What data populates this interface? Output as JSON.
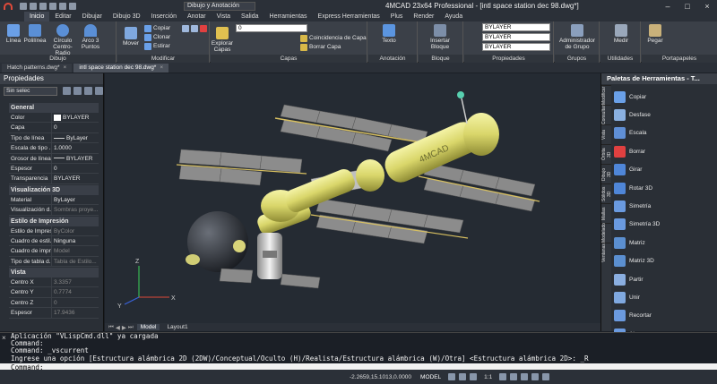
{
  "titlebar": {
    "workspace": "Dibujo y Anotación",
    "title": "4MCAD 23x64 Professional - [intl space station dec 98.dwg*]"
  },
  "ribbon_tabs": [
    "Inicio",
    "Editar",
    "Dibujar",
    "Dibujo 3D",
    "Inserción",
    "Anotar",
    "Vista",
    "Salida",
    "Herramientas",
    "Express Herramientas",
    "Plus",
    "Render",
    "Ayuda"
  ],
  "ribbon": {
    "draw_group": "Dibujo",
    "draw_tools": {
      "line": "Línea",
      "polyline": "Polilínea",
      "circle": "Círculo",
      "circle_sub": "Centro-Radio",
      "arc": "Arco 3",
      "arc_sub": "Puntos"
    },
    "modify_group": "Modificar",
    "modify_tools": {
      "move": "Mover",
      "copy": "Copiar",
      "clone": "Clonar",
      "stretch": "Estirar"
    },
    "layers_group": "Capas",
    "layer_tools": {
      "explore": "Explorar",
      "explore_sub": "Capas",
      "match": "Coincidencia de Capa",
      "delete": "Borrar Capa"
    },
    "layer_value": "0",
    "annotation_group": "Anotación",
    "annotation_tools": {
      "text": "Texto"
    },
    "block_group": "Bloque",
    "block_tools": {
      "insert": "Insertar",
      "insert_sub": "Bloque"
    },
    "properties_group": "Propiedades",
    "property_values": {
      "color": "BYLAYER",
      "linetype": "BYLAYER",
      "lineweight": "BYLAYER"
    },
    "groups_group": "Grupos",
    "group_tools": {
      "manager": "Administrador",
      "manager_sub": "de Grupo"
    },
    "utilities_group": "Utilidades",
    "utility_tools": {
      "measure": "Medir"
    },
    "clipboard_group": "Portapapeles",
    "clipboard_tools": {
      "paste": "Pegar"
    }
  },
  "doc_tabs": [
    "Hatch patterns.dwg*",
    "intl space station dec 98.dwg*"
  ],
  "properties": {
    "title": "Propiedades",
    "selection": "Sin selec",
    "categories": [
      {
        "name": "General",
        "rows": [
          {
            "k": "Color",
            "v": "BYLAYER",
            "kind": "swatch"
          },
          {
            "k": "Capa",
            "v": "0"
          },
          {
            "k": "Tipo de línea",
            "v": "ByLayer",
            "kind": "line"
          },
          {
            "k": "Escala de tipo ...",
            "v": "1.0000"
          },
          {
            "k": "Grosor de línea",
            "v": "BYLAYER",
            "kind": "line"
          },
          {
            "k": "Espesor",
            "v": "0"
          },
          {
            "k": "Transparencia",
            "v": "BYLAYER"
          }
        ]
      },
      {
        "name": "Visualización 3D",
        "rows": [
          {
            "k": "Material",
            "v": "ByLayer"
          },
          {
            "k": "Visualización d...",
            "v": "Sombras proye...",
            "dim": true
          }
        ]
      },
      {
        "name": "Estilo de Impresión",
        "rows": [
          {
            "k": "Estilo de Impres...",
            "v": "ByColor",
            "dim": true
          },
          {
            "k": "Cuadro de estil...",
            "v": "Ninguna"
          },
          {
            "k": "Cuadro de impr...",
            "v": "Model",
            "dim": true
          },
          {
            "k": "Tipo de tabla d...",
            "v": "Tabla de Estilo...",
            "dim": true
          }
        ]
      },
      {
        "name": "Vista",
        "rows": [
          {
            "k": "Centro X",
            "v": "3.3357",
            "dim": true
          },
          {
            "k": "Centro Y",
            "v": "0.7774",
            "dim": true
          },
          {
            "k": "Centro Z",
            "v": "0",
            "dim": true
          },
          {
            "k": "Espesor",
            "v": "17.9436",
            "dim": true
          }
        ]
      }
    ]
  },
  "viewport": {
    "label_text": "4MCAD",
    "tabs": [
      "Model",
      "Layout1"
    ]
  },
  "palette": {
    "title": "Paletas de Herramientas - T...",
    "vertical_tabs": [
      "Modificar",
      "Consultar",
      "Vista",
      "Órbita 3D",
      "Dibujo 3D",
      "Sólidos 3D",
      "Mallas",
      "Modelado",
      "Ventanas"
    ],
    "items": [
      {
        "label": "Copiar",
        "color": "#6aa0e8"
      },
      {
        "label": "Desfase",
        "color": "#8ab0e0"
      },
      {
        "label": "Escala",
        "color": "#5f8fd6"
      },
      {
        "label": "Borrar",
        "color": "#e04040"
      },
      {
        "label": "Girar",
        "color": "#4f86d8"
      },
      {
        "label": "Rotar 3D",
        "color": "#4f86d8"
      },
      {
        "label": "Simetría",
        "color": "#6a9ae0"
      },
      {
        "label": "Simetría 3D",
        "color": "#6a9ae0"
      },
      {
        "label": "Matriz",
        "color": "#5b8fd0"
      },
      {
        "label": "Matriz 3D",
        "color": "#5b8fd0"
      },
      {
        "label": "Partir",
        "color": "#8aaee0"
      },
      {
        "label": "Unir",
        "color": "#7fa8df"
      },
      {
        "label": "Recortar",
        "color": "#6b9adf"
      },
      {
        "label": "Alargar",
        "color": "#6b9adf"
      }
    ]
  },
  "command": {
    "lines": [
      "Aplicación \"VLispCmd.dll\" ya cargada",
      "Command:",
      "Command: _vscurrent",
      "Ingrese una opción [Estructura alámbrica 2D (2DW)/Conceptual/Oculto (H)/Realista/Estructura alámbrica (W)/Otra] <Estructura alámbrica 2D>: _R"
    ],
    "prompt": "Command:"
  },
  "status": {
    "coords": "-2.2659,15.1013,0.0000",
    "mode": "MODEL",
    "scale": "1:1"
  }
}
